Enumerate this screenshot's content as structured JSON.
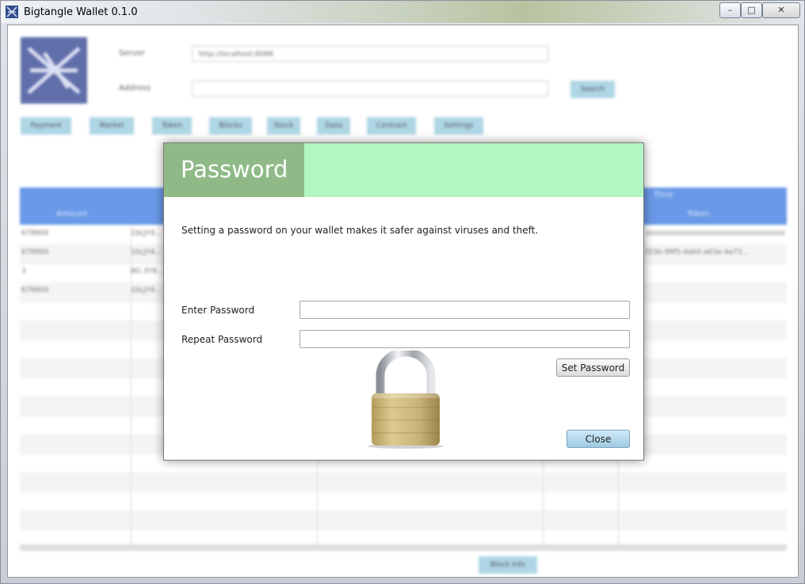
{
  "window": {
    "title": "Bigtangle  Wallet 0.1.0",
    "controls": {
      "minimize": "–",
      "maximize": "□",
      "close": "✕"
    }
  },
  "header": {
    "server_label": "Server",
    "server_value": "http://localhost:8088",
    "address_label": "Address",
    "address_value": "",
    "search_label": "Search"
  },
  "nav": {
    "items": [
      "Payment",
      "Market",
      "Token",
      "Blocks",
      "Stock",
      "Data",
      "Contract",
      "Settings"
    ]
  },
  "table": {
    "headers": {
      "amount": "Amount",
      "time": "Time",
      "token": "Token"
    },
    "rows": [
      {
        "amount": "678900",
        "addr": "1bLJY4...",
        "token": "xxxxxxxxxxxxxxxxxxxxxxxxxxxxxxxxx"
      },
      {
        "amount": "678900",
        "addr": "1bLJY4...",
        "token": "f23b-99f5-4ab0-a03a-4a73..."
      },
      {
        "amount": "3",
        "addr": "BG.3Y8...",
        "token": ""
      },
      {
        "amount": "678900",
        "addr": "1bLJY4...",
        "token": ""
      }
    ]
  },
  "footer": {
    "block_info_label": "Block Info"
  },
  "dialog": {
    "title": "Password",
    "description": "Setting a password on your wallet makes it safer against viruses and theft.",
    "enter_label": "Enter Password",
    "repeat_label": "Repeat Password",
    "enter_value": "",
    "repeat_value": "",
    "set_button": "Set Password",
    "close_button": "Close"
  },
  "colors": {
    "dialog_header_accent": "#8fba88",
    "dialog_header_bg": "#b3f6c3",
    "table_header_bg": "#5d91e6",
    "blue_button": "#a9d3e3"
  },
  "icons": {
    "app": "app-logo-icon",
    "lock": "padlock-icon"
  }
}
